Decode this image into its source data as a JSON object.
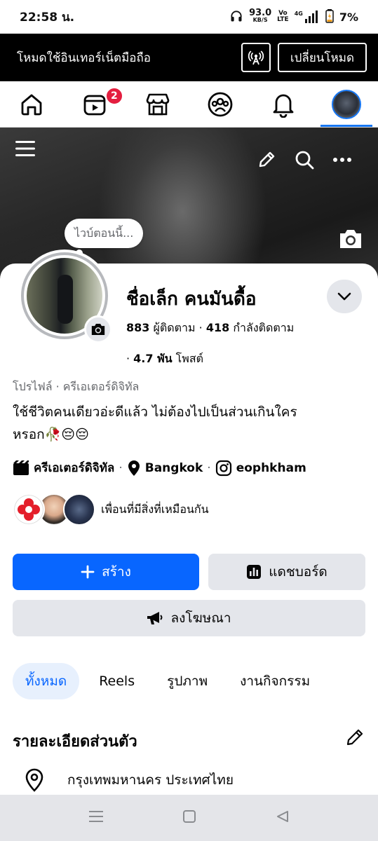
{
  "status_bar": {
    "time": "22:58 น.",
    "net_speed": "93.0",
    "net_speed_unit": "KB/S",
    "volte_top": "Vo",
    "volte_bottom": "LTE",
    "network": "4G",
    "battery": "7%"
  },
  "banner": {
    "text": "โหมดใช้อินเทอร์เน็ตมือถือ",
    "switch_label": "เปลี่ยนโหมด"
  },
  "nav": {
    "video_badge": "2",
    "active": "profile"
  },
  "profile": {
    "status_bubble": "ไวบ์ตอนนี้...",
    "name": "ชื่อเล็ก คนมันดื้อ",
    "followers_count": "883",
    "followers_label": "ผู้ติดตาม",
    "following_count": "418",
    "following_label": "กำลังติดตาม",
    "posts_count": "4.7 พัน",
    "posts_label": "โพสต์",
    "category": "โปรไฟล์ · ครีเอเตอร์ดิจิทัล",
    "bio_line1": "ใช้ชีวิตคนเดียวอ่ะดีแล้ว ไม่ต้องไปเป็นส่วนเกินใคร",
    "bio_line2": "หรอก🥀😔😔",
    "creator_label": "ครีเอเตอร์ดิจิทัล",
    "location": "Bangkok",
    "instagram": "eophkham",
    "mutual_text": "เพื่อนที่มีสิ่งที่เหมือนกัน"
  },
  "actions": {
    "create": "สร้าง",
    "dashboard": "แดชบอร์ด",
    "advertise": "ลงโฆษณา"
  },
  "tabs": [
    {
      "label": "ทั้งหมด",
      "active": true
    },
    {
      "label": "Reels",
      "active": false
    },
    {
      "label": "รูปภาพ",
      "active": false
    },
    {
      "label": "งานกิจกรรม",
      "active": false
    }
  ],
  "details": {
    "title": "รายละเอียดส่วนตัว",
    "location_line": "กรุงเทพมหานคร ประเทศไทย"
  },
  "colors": {
    "primary": "#0866ff",
    "badge": "#e41e3f",
    "secondary_button": "#e4e6eb"
  }
}
